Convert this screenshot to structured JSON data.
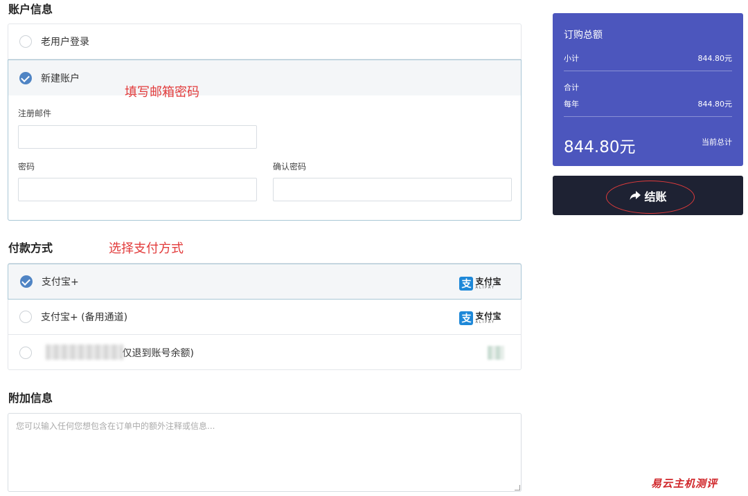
{
  "account": {
    "title": "账户信息",
    "existing_user": "老用户登录",
    "new_account": "新建账户",
    "email_label": "注册邮件",
    "password_label": "密码",
    "confirm_password_label": "确认密码",
    "email_value": "",
    "password_value": "",
    "confirm_password_value": ""
  },
  "payment": {
    "title": "付款方式",
    "options": [
      {
        "label": "支付宝+",
        "logo_text": "支付宝",
        "logo_en": "ALIPAY",
        "selected": true
      },
      {
        "label": "支付宝+ (备用通道)",
        "logo_text": "支付宝",
        "logo_en": "ALIPAY",
        "selected": false
      },
      {
        "label": "(仅退到账号余额)",
        "selected": false
      }
    ]
  },
  "additional": {
    "title": "附加信息",
    "placeholder": "您可以输入任何您想包含在订单中的额外注释或信息..."
  },
  "summary": {
    "title": "订购总额",
    "subtotal_label": "小计",
    "subtotal_value": "844.80元",
    "total_label": "合计",
    "yearly_label": "每年",
    "yearly_value": "844.80元",
    "grand_total": "844.80元",
    "grand_total_label": "当前总计"
  },
  "checkout": {
    "label": "结账"
  },
  "annotations": {
    "fill_email": "填写邮箱密码",
    "choose_payment": "选择支付方式"
  },
  "watermark": "易云主机测评",
  "colors": {
    "summary_bg": "#4c56bd",
    "checkout_bg": "#1e2233",
    "radio_checked": "#4f84c4",
    "annotation": "#e23b3b"
  }
}
